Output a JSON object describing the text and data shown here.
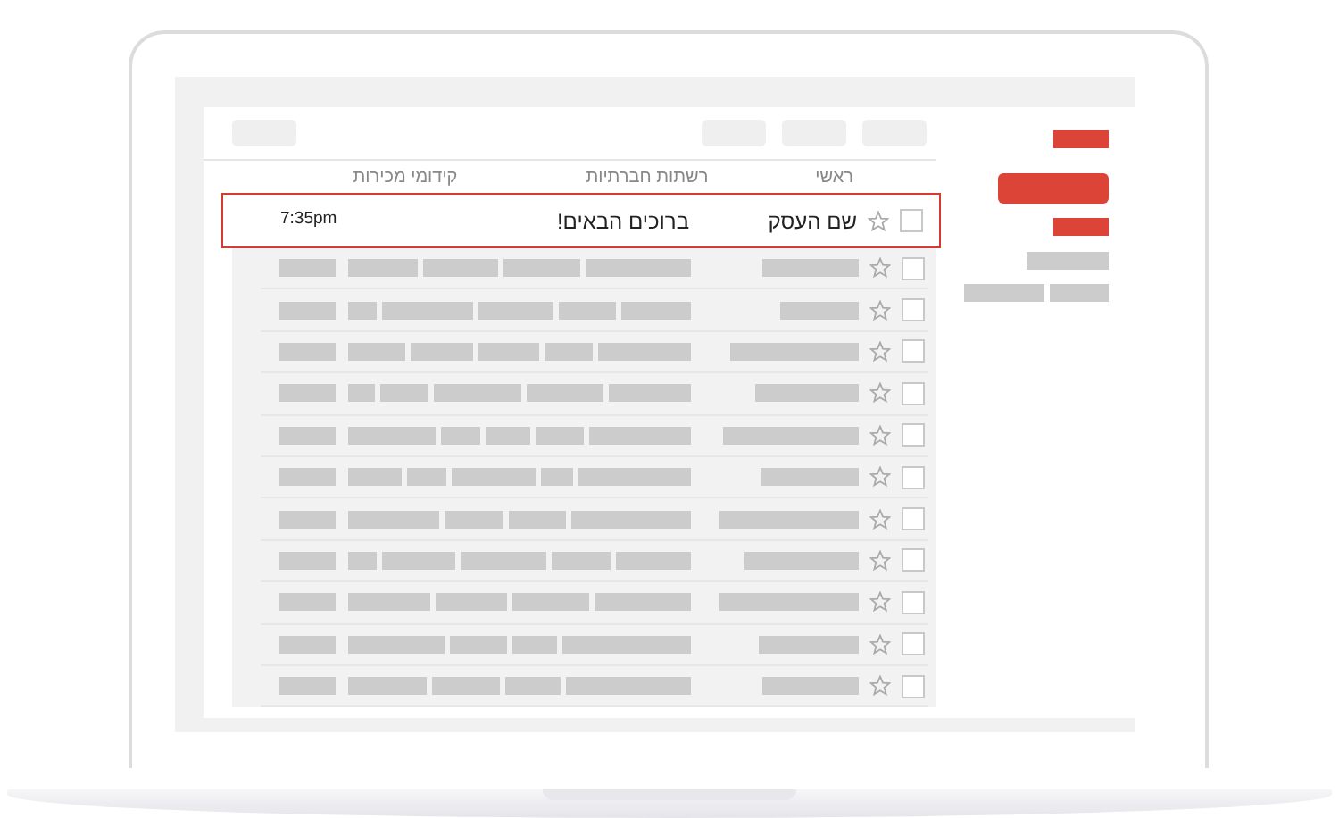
{
  "tabs": [
    {
      "label": "ראשי"
    },
    {
      "label": "רשתות חברתיות"
    },
    {
      "label": "קידומי מכירות"
    }
  ],
  "rows": [
    {
      "kind": "message",
      "highlighted": true,
      "checked": false,
      "starred": false,
      "sender": "שם העסק",
      "subject": "ברוכים הבאים!",
      "time": "7:35pm"
    },
    {
      "kind": "placeholder",
      "highlighted": false,
      "checked": false,
      "starred": false
    },
    {
      "kind": "placeholder",
      "highlighted": false,
      "checked": false,
      "starred": false
    },
    {
      "kind": "placeholder",
      "highlighted": false,
      "checked": false,
      "starred": false
    },
    {
      "kind": "placeholder",
      "highlighted": false,
      "checked": false,
      "starred": false
    },
    {
      "kind": "placeholder",
      "highlighted": false,
      "checked": false,
      "starred": false
    },
    {
      "kind": "placeholder",
      "highlighted": false,
      "checked": false,
      "starred": false
    },
    {
      "kind": "placeholder",
      "highlighted": false,
      "checked": false,
      "starred": false
    },
    {
      "kind": "placeholder",
      "highlighted": false,
      "checked": false,
      "starred": false
    },
    {
      "kind": "placeholder",
      "highlighted": false,
      "checked": false,
      "starred": false
    },
    {
      "kind": "placeholder",
      "highlighted": false,
      "checked": false,
      "starred": false
    },
    {
      "kind": "placeholder",
      "highlighted": false,
      "checked": false,
      "starred": false
    }
  ]
}
